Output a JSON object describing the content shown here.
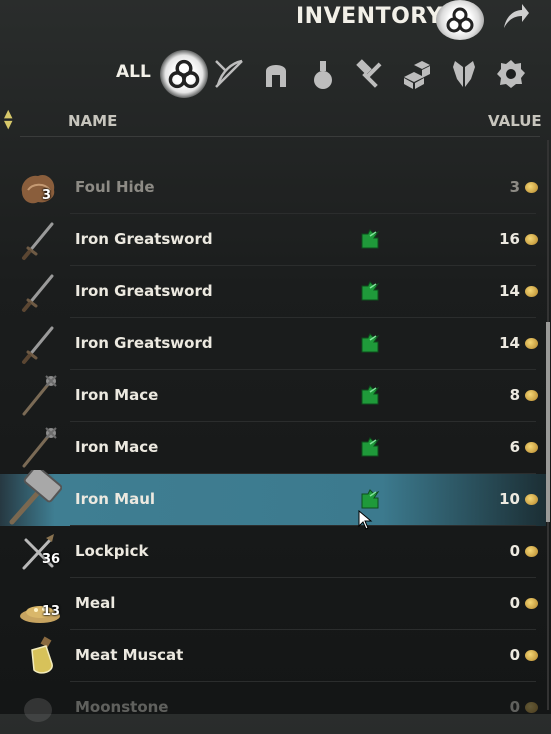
{
  "header": {
    "title": "INVENTORY"
  },
  "filters": {
    "all_label": "ALL",
    "icons": [
      "all-items-icon",
      "weapons-icon",
      "apparel-icon",
      "consumables-icon",
      "crafting-icon",
      "furnishings-icon",
      "quest-items-icon",
      "junk-icon"
    ],
    "active": "all-items-icon"
  },
  "columns": {
    "name": "NAME",
    "value": "VALUE"
  },
  "rows": [
    {
      "name": "Foul Hide",
      "qty": "3",
      "value": "3",
      "icon": "hide-icon",
      "stolen": false
    },
    {
      "name": "Iron Greatsword",
      "qty": "",
      "value": "16",
      "icon": "greatsword-icon",
      "stolen": true
    },
    {
      "name": "Iron Greatsword",
      "qty": "",
      "value": "14",
      "icon": "greatsword-icon",
      "stolen": true
    },
    {
      "name": "Iron Greatsword",
      "qty": "",
      "value": "14",
      "icon": "greatsword-icon",
      "stolen": true
    },
    {
      "name": "Iron Mace",
      "qty": "",
      "value": "8",
      "icon": "mace-icon",
      "stolen": true
    },
    {
      "name": "Iron Mace",
      "qty": "",
      "value": "6",
      "icon": "mace-icon",
      "stolen": true
    },
    {
      "name": "Iron Maul",
      "qty": "",
      "value": "10",
      "icon": "maul-icon",
      "stolen": true,
      "selected": true
    },
    {
      "name": "Lockpick",
      "qty": "36",
      "value": "0",
      "icon": "lockpick-icon",
      "stolen": false
    },
    {
      "name": "Meal",
      "qty": "13",
      "value": "0",
      "icon": "meal-icon",
      "stolen": false
    },
    {
      "name": "Meat Muscat",
      "qty": "",
      "value": "0",
      "icon": "potion-bottle-icon",
      "stolen": false
    },
    {
      "name": "Moonstone",
      "qty": "",
      "value": "0",
      "icon": "moonstone-icon",
      "stolen": false
    }
  ],
  "colors": {
    "selection": "#3c7a8e",
    "stolen_badge": "#1f9a3a",
    "gold": "#d8b04a"
  }
}
